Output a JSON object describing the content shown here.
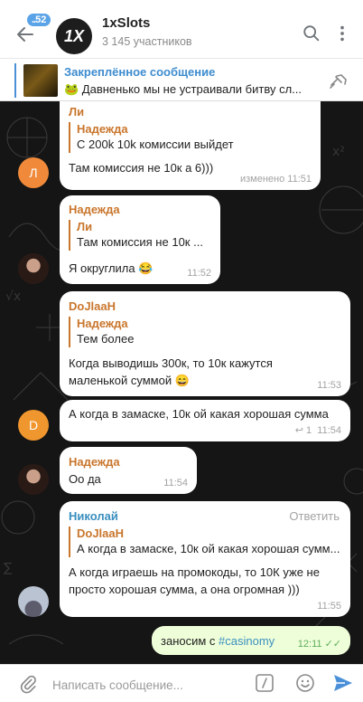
{
  "header": {
    "unread_badge": "52",
    "avatar_text": "1X",
    "title": "1xSlots",
    "subtitle": "3 145 участников"
  },
  "pinned": {
    "title": "Закреплённое сообщение",
    "text": "🐸 Давненько мы не устраивали битву сл..."
  },
  "messages": [
    {
      "sender": "Ли",
      "reply_name": "Надежда",
      "reply_text": "С 200k 10k комиссии выйдет",
      "text": "Там комиссия не 10к а 6)))",
      "time": "изменено 11:51",
      "avatar_letter": "Л"
    },
    {
      "sender": "Надежда",
      "reply_name": "Ли",
      "reply_text": "Там комиссия не 10к ...",
      "text": "Я округлила 😂",
      "time": "11:52"
    },
    {
      "sender": "DoJlaaH",
      "reply_name": "Надежда",
      "reply_text": "Тем более",
      "text": "Когда выводишь 300к, то 10к кажутся маленькой суммой 😄",
      "time": "11:53"
    },
    {
      "text": "А когда в замаске, 10к ой какая хорошая сумма",
      "replies_count": "1",
      "time": "11:54",
      "avatar_letter": "D"
    },
    {
      "sender": "Надежда",
      "text": "Оо да",
      "time": "11:54"
    },
    {
      "sender": "Николай",
      "action": "Ответить",
      "reply_name": "DoJlaaH",
      "reply_text": "А когда в замаске, 10к ой какая хорошая сумм...",
      "text": "А когда играешь на промокоды, то 10К уже не просто хорошая сумма, а она огромная )))",
      "time": "11:55"
    },
    {
      "text_prefix": "заносим с ",
      "hashtag": "#casinomy",
      "time": "12:11"
    }
  ],
  "composer": {
    "placeholder": "Написать сообщение..."
  },
  "colors": {
    "accent": "#4a90d9",
    "orange_name": "#c9762c",
    "nikolay_name": "#3a8fbf",
    "own_bubble": "#eefed9",
    "chat_bg": "#151515"
  }
}
